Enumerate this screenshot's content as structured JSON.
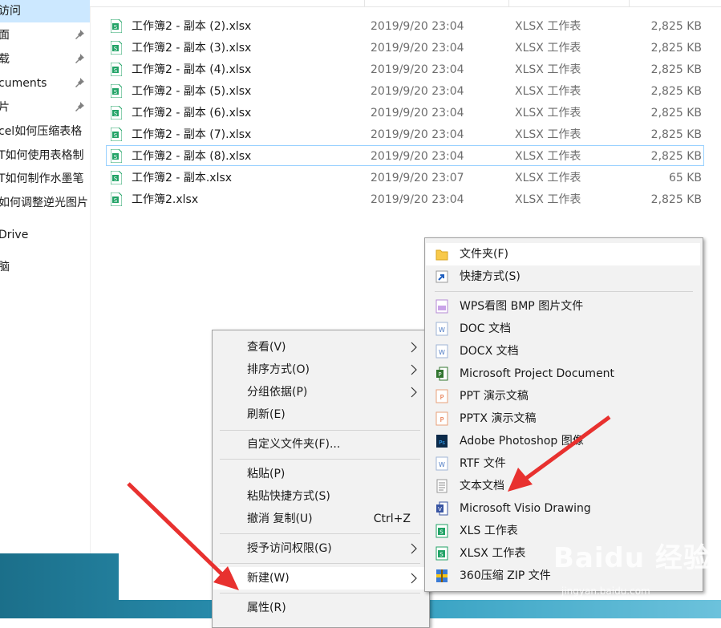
{
  "sidebar": {
    "items": [
      {
        "label": "访问",
        "pinned": false,
        "active": true
      },
      {
        "label": "面",
        "pinned": true
      },
      {
        "label": "载",
        "pinned": true
      },
      {
        "label": "cuments",
        "pinned": true
      },
      {
        "label": "片",
        "pinned": true
      },
      {
        "label": "cel如何压缩表格",
        "pinned": false
      },
      {
        "label": "T如何使用表格制",
        "pinned": false
      },
      {
        "label": "T如何制作水墨笔",
        "pinned": false
      },
      {
        "label": "如何调整逆光图片",
        "pinned": false
      },
      {
        "label": "Drive",
        "pinned": false
      },
      {
        "label": "脑",
        "pinned": false
      }
    ]
  },
  "files": [
    {
      "name": "工作簿2 - 副本 (2).xlsx",
      "date": "2019/9/20 23:04",
      "type": "XLSX 工作表",
      "size": "2,825 KB"
    },
    {
      "name": "工作簿2 - 副本 (3).xlsx",
      "date": "2019/9/20 23:04",
      "type": "XLSX 工作表",
      "size": "2,825 KB"
    },
    {
      "name": "工作簿2 - 副本 (4).xlsx",
      "date": "2019/9/20 23:04",
      "type": "XLSX 工作表",
      "size": "2,825 KB"
    },
    {
      "name": "工作簿2 - 副本 (5).xlsx",
      "date": "2019/9/20 23:04",
      "type": "XLSX 工作表",
      "size": "2,825 KB"
    },
    {
      "name": "工作簿2 - 副本 (6).xlsx",
      "date": "2019/9/20 23:04",
      "type": "XLSX 工作表",
      "size": "2,825 KB"
    },
    {
      "name": "工作簿2 - 副本 (7).xlsx",
      "date": "2019/9/20 23:04",
      "type": "XLSX 工作表",
      "size": "2,825 KB"
    },
    {
      "name": "工作簿2 - 副本 (8).xlsx",
      "date": "2019/9/20 23:04",
      "type": "XLSX 工作表",
      "size": "2,825 KB",
      "selected": true
    },
    {
      "name": "工作簿2 - 副本.xlsx",
      "date": "2019/9/20 23:07",
      "type": "XLSX 工作表",
      "size": "65 KB"
    },
    {
      "name": "工作簿2.xlsx",
      "date": "2019/9/20 23:04",
      "type": "XLSX 工作表",
      "size": "2,825 KB"
    }
  ],
  "context_menu": {
    "view": "查看(V)",
    "sort": "排序方式(O)",
    "group": "分组依据(P)",
    "refresh": "刷新(E)",
    "customize": "自定义文件夹(F)...",
    "paste": "粘贴(P)",
    "paste_shortcut": "粘贴快捷方式(S)",
    "undo": "撤消 复制(U)",
    "undo_shortcut": "Ctrl+Z",
    "grant_access": "授予访问权限(G)",
    "new": "新建(W)",
    "properties": "属性(R)"
  },
  "new_submenu": {
    "items": [
      {
        "label": "文件夹(F)",
        "icon": "folder-icon"
      },
      {
        "label": "快捷方式(S)",
        "icon": "shortcut-icon"
      },
      {
        "label": "WPS看图 BMP 图片文件",
        "icon": "bmp-icon"
      },
      {
        "label": "DOC 文档",
        "icon": "doc-icon"
      },
      {
        "label": "DOCX 文档",
        "icon": "docx-icon"
      },
      {
        "label": "Microsoft Project Document",
        "icon": "project-icon"
      },
      {
        "label": "PPT 演示文稿",
        "icon": "ppt-icon"
      },
      {
        "label": "PPTX 演示文稿",
        "icon": "pptx-icon"
      },
      {
        "label": "Adobe Photoshop 图像",
        "icon": "photoshop-icon"
      },
      {
        "label": "RTF 文件",
        "icon": "rtf-icon"
      },
      {
        "label": "文本文档",
        "icon": "text-document-icon"
      },
      {
        "label": "Microsoft Visio Drawing",
        "icon": "visio-icon"
      },
      {
        "label": "XLS 工作表",
        "icon": "xls-icon"
      },
      {
        "label": "XLSX 工作表",
        "icon": "xlsx-icon"
      },
      {
        "label": "360压缩 ZIP 文件",
        "icon": "zip-icon"
      }
    ]
  },
  "watermark": {
    "text": "Baidu 经验",
    "sub": "jingyan.baidu.com"
  },
  "colors": {
    "selection": "#cce8ff",
    "selected_border": "#99d1ff",
    "menu_bg": "#f2f2f2",
    "annotation_arrow": "#e8312f",
    "excel_green": "#21a366"
  }
}
